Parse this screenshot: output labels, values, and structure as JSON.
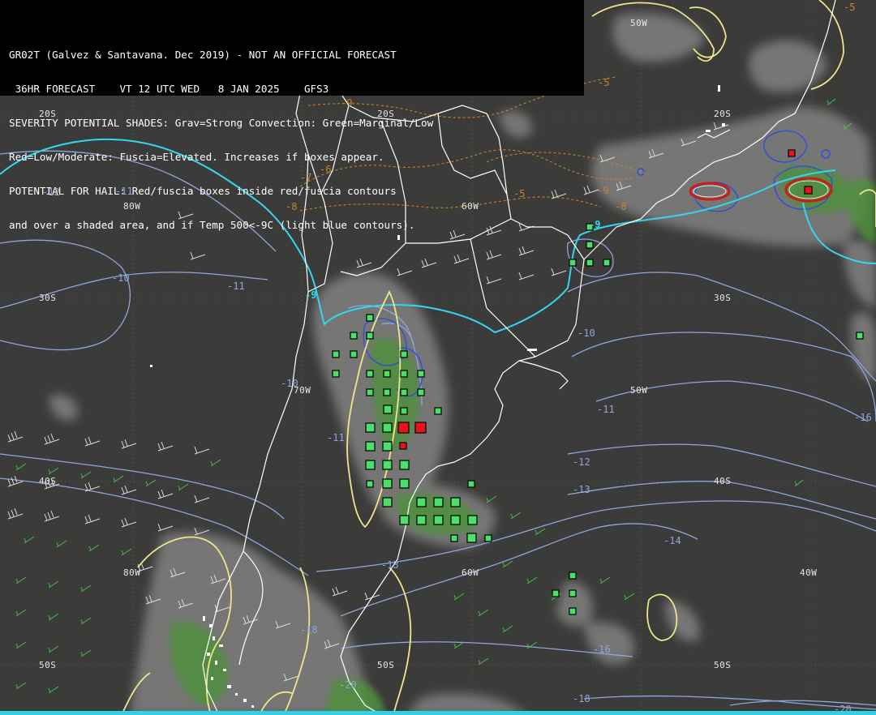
{
  "header": {
    "lines": [
      "GR02T (Galvez & Santavana. Dec 2019) - NOT AN OFFICIAL FORECAST",
      " 36HR FORECAST    VT 12 UTC WED   8 JAN 2025    GFS3",
      "SEVERITY POTENTIAL SHADES: Grav=Strong Convection: Green=Marginal/Low",
      "Red=Low/Moderate: Fuscia=Elevated. Increases if boxes appear.",
      "POTENTIAL FOR HAIL: Red/fuscia boxes inside red/fuscia contours",
      "and over a shaded area, and if Temp 500<-9C (light blue contours)."
    ]
  },
  "grid_labels": {
    "lat_20s_a": "20S",
    "lat_20s_b": "20S",
    "lat_20s_c": "20S",
    "lat_30s_a": "30S",
    "lat_30s_b": "30S",
    "lat_40s_a": "40S",
    "lat_40s_b": "40S",
    "lat_50s_a": "50S",
    "lat_50s_b": "50S",
    "lat_50s_c": "50S",
    "lon_80w_a": "80W",
    "lon_80w_b": "80W",
    "lon_70w": "70W",
    "lon_60w_a": "60W",
    "lon_60w_b": "60W",
    "lon_50w_a": "50W",
    "lon_50w_b": "50W",
    "lon_40w": "40W"
  },
  "temp_labels": {
    "m12_a": "-12",
    "m11_a": "-11",
    "m10_a": "-10",
    "m11_b": "-11",
    "m10_b": "-10",
    "m11_c": "-11",
    "m10_c": "-10",
    "m11_d": "-11",
    "m12_b": "-12",
    "m13": "-13",
    "m14": "-14",
    "m16_a": "-16",
    "m16_b": "-16",
    "m18_a": "-18",
    "m18_b": "-18",
    "m20_a": "-20",
    "m20_b": "-20",
    "m13_b": "-13",
    "m9_a": "-9",
    "m9_b": "-9",
    "m9_c": "-9",
    "m5_a": "-5",
    "m5_b": "-5",
    "m6": "-6",
    "m7": "-7",
    "m8_a": "-8",
    "m8_b": "-8",
    "m9_d": "-9",
    "m5_c": "-5"
  },
  "colors": {
    "background": "#3b3b39",
    "gray_shade": "#8a8a8a",
    "green_shade": "#4f8f3e",
    "yellow_contour": "#f0e58a",
    "blue_isotherm": "#8fa6dc",
    "cyan_isotherm": "#35d6f0",
    "orange_contour": "#c9812c",
    "coast": "#ffffff",
    "marginal_box": "#4ce06a",
    "moderate_box": "#e8141c",
    "red_contour": "#cc1b1b"
  }
}
